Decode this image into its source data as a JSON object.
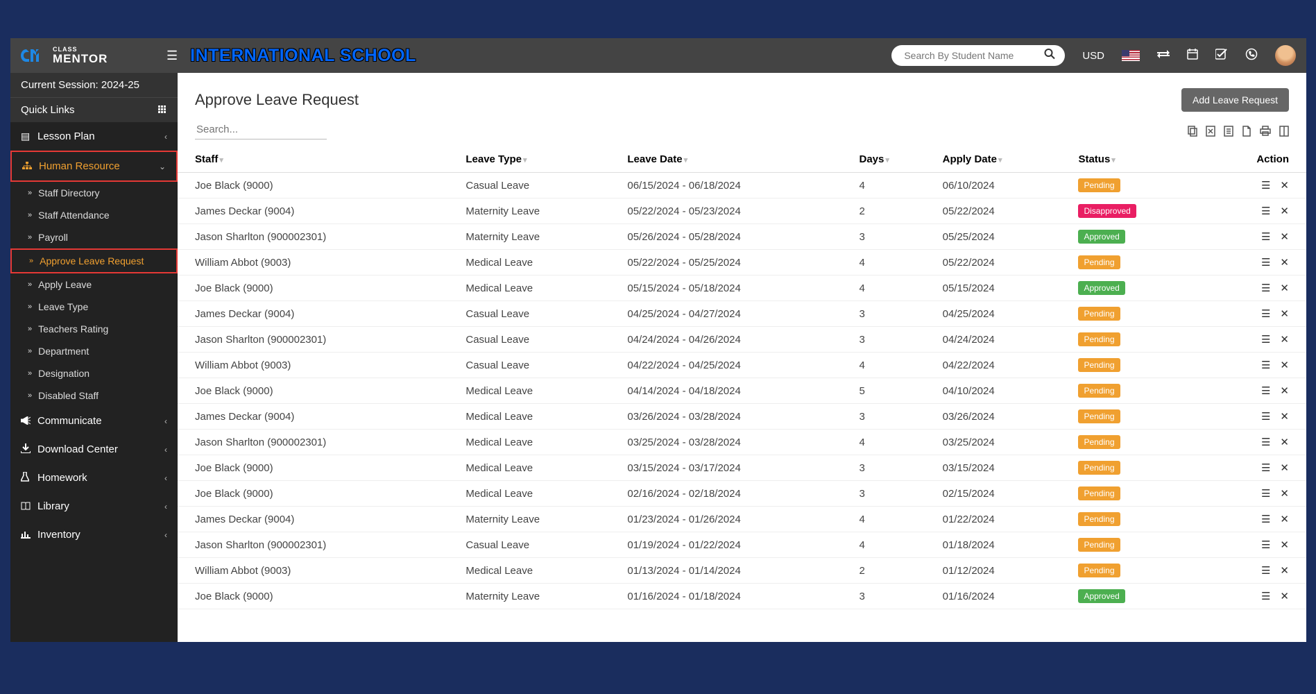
{
  "topbar": {
    "logo_line1": "CLASS",
    "logo_line2": "MENTOR",
    "school_name": "INTERNATIONAL SCHOOL",
    "search_placeholder": "Search By Student Name",
    "currency": "USD"
  },
  "sidebar": {
    "session_label": "Current Session: 2024-25",
    "quick_links_label": "Quick Links",
    "menu": {
      "lesson_plan": "Lesson Plan",
      "human_resource": "Human Resource",
      "communicate": "Communicate",
      "download_center": "Download Center",
      "homework": "Homework",
      "library": "Library",
      "inventory": "Inventory"
    },
    "hr_sub": {
      "staff_directory": "Staff Directory",
      "staff_attendance": "Staff Attendance",
      "payroll": "Payroll",
      "approve_leave_request": "Approve Leave Request",
      "apply_leave": "Apply Leave",
      "leave_type": "Leave Type",
      "teachers_rating": "Teachers Rating",
      "department": "Department",
      "designation": "Designation",
      "disabled_staff": "Disabled Staff"
    }
  },
  "page": {
    "title": "Approve Leave Request",
    "add_button": "Add Leave Request",
    "search_placeholder": "Search..."
  },
  "columns": {
    "staff": "Staff",
    "leave_type": "Leave Type",
    "leave_date": "Leave Date",
    "days": "Days",
    "apply_date": "Apply Date",
    "status": "Status",
    "action": "Action"
  },
  "status_labels": {
    "pending": "Pending",
    "approved": "Approved",
    "disapproved": "Disapproved"
  },
  "rows": [
    {
      "staff": "Joe Black (9000)",
      "leave_type": "Casual Leave",
      "leave_date": "06/15/2024 - 06/18/2024",
      "days": "4",
      "apply_date": "06/10/2024",
      "status": "pending"
    },
    {
      "staff": "James Deckar (9004)",
      "leave_type": "Maternity Leave",
      "leave_date": "05/22/2024 - 05/23/2024",
      "days": "2",
      "apply_date": "05/22/2024",
      "status": "disapproved"
    },
    {
      "staff": "Jason Sharlton (900002301)",
      "leave_type": "Maternity Leave",
      "leave_date": "05/26/2024 - 05/28/2024",
      "days": "3",
      "apply_date": "05/25/2024",
      "status": "approved"
    },
    {
      "staff": "William Abbot (9003)",
      "leave_type": "Medical Leave",
      "leave_date": "05/22/2024 - 05/25/2024",
      "days": "4",
      "apply_date": "05/22/2024",
      "status": "pending"
    },
    {
      "staff": "Joe Black (9000)",
      "leave_type": "Medical Leave",
      "leave_date": "05/15/2024 - 05/18/2024",
      "days": "4",
      "apply_date": "05/15/2024",
      "status": "approved"
    },
    {
      "staff": "James Deckar (9004)",
      "leave_type": "Casual Leave",
      "leave_date": "04/25/2024 - 04/27/2024",
      "days": "3",
      "apply_date": "04/25/2024",
      "status": "pending"
    },
    {
      "staff": "Jason Sharlton (900002301)",
      "leave_type": "Casual Leave",
      "leave_date": "04/24/2024 - 04/26/2024",
      "days": "3",
      "apply_date": "04/24/2024",
      "status": "pending"
    },
    {
      "staff": "William Abbot (9003)",
      "leave_type": "Casual Leave",
      "leave_date": "04/22/2024 - 04/25/2024",
      "days": "4",
      "apply_date": "04/22/2024",
      "status": "pending"
    },
    {
      "staff": "Joe Black (9000)",
      "leave_type": "Medical Leave",
      "leave_date": "04/14/2024 - 04/18/2024",
      "days": "5",
      "apply_date": "04/10/2024",
      "status": "pending"
    },
    {
      "staff": "James Deckar (9004)",
      "leave_type": "Medical Leave",
      "leave_date": "03/26/2024 - 03/28/2024",
      "days": "3",
      "apply_date": "03/26/2024",
      "status": "pending"
    },
    {
      "staff": "Jason Sharlton (900002301)",
      "leave_type": "Medical Leave",
      "leave_date": "03/25/2024 - 03/28/2024",
      "days": "4",
      "apply_date": "03/25/2024",
      "status": "pending"
    },
    {
      "staff": "Joe Black (9000)",
      "leave_type": "Medical Leave",
      "leave_date": "03/15/2024 - 03/17/2024",
      "days": "3",
      "apply_date": "03/15/2024",
      "status": "pending"
    },
    {
      "staff": "Joe Black (9000)",
      "leave_type": "Medical Leave",
      "leave_date": "02/16/2024 - 02/18/2024",
      "days": "3",
      "apply_date": "02/15/2024",
      "status": "pending"
    },
    {
      "staff": "James Deckar (9004)",
      "leave_type": "Maternity Leave",
      "leave_date": "01/23/2024 - 01/26/2024",
      "days": "4",
      "apply_date": "01/22/2024",
      "status": "pending"
    },
    {
      "staff": "Jason Sharlton (900002301)",
      "leave_type": "Casual Leave",
      "leave_date": "01/19/2024 - 01/22/2024",
      "days": "4",
      "apply_date": "01/18/2024",
      "status": "pending"
    },
    {
      "staff": "William Abbot (9003)",
      "leave_type": "Medical Leave",
      "leave_date": "01/13/2024 - 01/14/2024",
      "days": "2",
      "apply_date": "01/12/2024",
      "status": "pending"
    },
    {
      "staff": "Joe Black (9000)",
      "leave_type": "Maternity Leave",
      "leave_date": "01/16/2024 - 01/18/2024",
      "days": "3",
      "apply_date": "01/16/2024",
      "status": "approved"
    }
  ]
}
